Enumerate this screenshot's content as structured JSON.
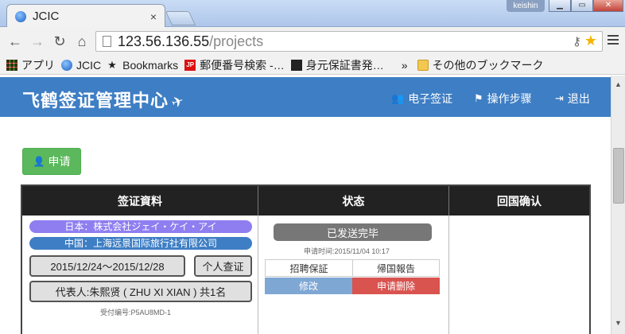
{
  "browser": {
    "tab_title": "JCIC",
    "tab_close": "×",
    "user_badge": "keishin",
    "window_buttons": [
      "▁",
      "▭",
      "✕"
    ],
    "url_host": "123.56.136.55",
    "url_path": "/projects",
    "bookmarks": [
      {
        "label": "アプリ",
        "icon": "apps-icon"
      },
      {
        "label": "JCIC",
        "icon": "globe-icon"
      },
      {
        "label": "Bookmarks",
        "icon": "star-icon"
      },
      {
        "label": "郵便番号検索 -…",
        "icon": "jp-post-icon"
      },
      {
        "label": "身元保証書発…",
        "icon": "doc-icon"
      }
    ],
    "bookmarks_more": "»",
    "other_bookmarks": "その他のブックマーク"
  },
  "navbar": {
    "brand": "飞鹤签证管理中心",
    "brand_icon": "✈",
    "links": [
      {
        "label": "电子签证",
        "icon": "users-icon"
      },
      {
        "label": "操作步骤",
        "icon": "flag-icon"
      },
      {
        "label": "退出",
        "icon": "sign-out-icon"
      }
    ]
  },
  "apply_button": "申请",
  "table": {
    "headers": [
      "签证資料",
      "状态",
      "回国确认"
    ],
    "row": {
      "japan_company": "日本：株式会社ジェイ・ケイ・アイ",
      "china_agency": "中国：上海远景国际旅行社有限公司",
      "date_range": "2015/12/24～2015/12/28",
      "visa_type": "个人查证",
      "representative": "代表人:朱熙贤 ( ZHU XI XIAN ) 共1名",
      "receipt_no": "受付编号:P5AU8MD-1",
      "status": "已发送完毕",
      "applied_time": "申请时间:2015/11/04 10:17",
      "doc_invite": "招聘保証",
      "doc_return": "帰国報告",
      "edit": "修改",
      "delete": "申请删除"
    }
  },
  "colors": {
    "navbar": "#3e7ec4",
    "apply": "#5cb85c",
    "edit": "#7fa7d4",
    "delete": "#d9534f",
    "jp_pill": "#8f7ef0",
    "cn_pill": "#3e7ec4"
  }
}
